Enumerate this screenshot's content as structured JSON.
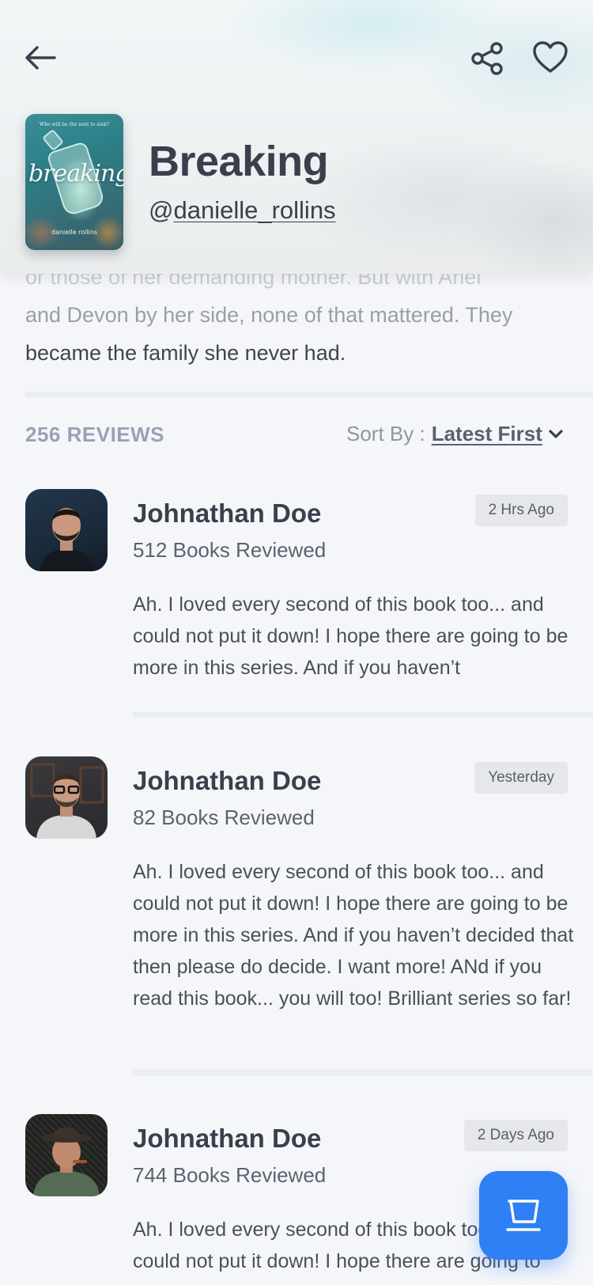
{
  "header": {
    "book_title": "Breaking",
    "author_at": "@",
    "author_handle": "danielle_rollins",
    "cover": {
      "tagline": "Who will be the next to sink?",
      "title": "breaking",
      "author": "danielle rollins"
    }
  },
  "description": {
    "line1": "or those of her demanding mother. But with Ariel",
    "line2": "and Devon by her side, none of that mattered. They",
    "line3": "became the family she never had."
  },
  "reviews_header": {
    "count_label": "256 REVIEWS",
    "sort_label": "Sort By :",
    "sort_value": "Latest First"
  },
  "reviews": [
    {
      "name": "Johnathan Doe",
      "books_reviewed": "512 Books Reviewed",
      "time": "2 Hrs Ago",
      "text": "Ah. I loved every second of this book too... and could not put it down! I hope there are going to be more in this series. And if you haven’t"
    },
    {
      "name": "Johnathan Doe",
      "books_reviewed": "82 Books Reviewed",
      "time": "Yesterday",
      "text": "Ah. I loved every second of this book too... and could not put it down! I hope there are going to be more in this series. And if you haven’t decided that then please do decide. I want more! ANd if you read this book... you will too! Brilliant series so far!"
    },
    {
      "name": "Johnathan Doe",
      "books_reviewed": "744 Books Reviewed",
      "time": "2 Days Ago",
      "text": "Ah. I loved every second of this book too... and could not put it down! I hope there are going to"
    }
  ],
  "colors": {
    "accent": "#2f7ff5",
    "text_dark": "#3a3f4c",
    "muted": "#98a2b3",
    "background": "#f5f6f9"
  },
  "icons": {
    "back": "arrow-left-icon",
    "share": "share-icon",
    "favorite": "heart-icon",
    "sort": "chevron-down-icon",
    "cart": "cart-icon"
  }
}
